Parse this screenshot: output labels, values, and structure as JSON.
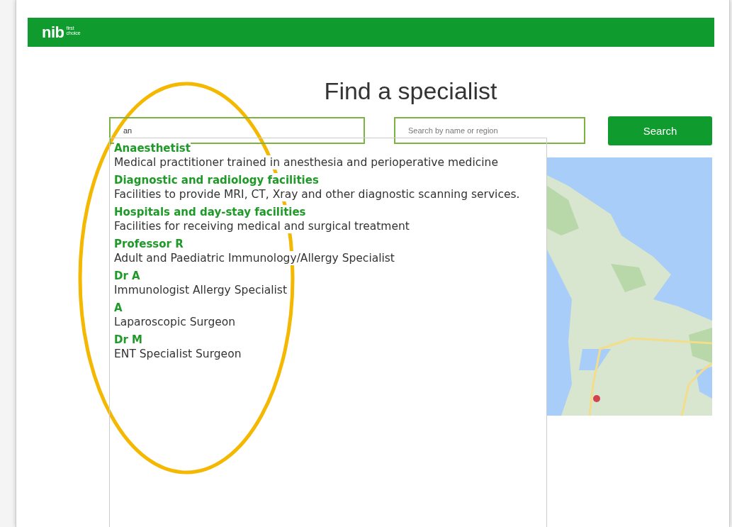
{
  "header": {
    "logo": "nib",
    "logo_top": "first",
    "logo_bottom": "choice"
  },
  "title": "Find a specialist",
  "search": {
    "specialty_value": "an",
    "region_placeholder": "Search by name or region",
    "button": "Search"
  },
  "suggestions": [
    {
      "name": "Anaesthetist",
      "description": "Medical practitioner trained in anesthesia and perioperative medicine"
    },
    {
      "name": "Diagnostic and radiology facilities",
      "description": "Facilities to provide MRI, CT, Xray and other diagnostic scanning services."
    },
    {
      "name": "Hospitals and day-stay facilities",
      "description": "Facilities for receiving medical and surgical treatment"
    },
    {
      "name": "Professor R",
      "description": "Adult and Paediatric Immunology/Allergy Specialist"
    },
    {
      "name": "Dr A",
      "description": "Immunologist Allergy Specialist"
    },
    {
      "name": "A",
      "description": "Laparoscopic Surgeon"
    },
    {
      "name": "Dr M",
      "description": "ENT Specialist Surgeon"
    }
  ]
}
